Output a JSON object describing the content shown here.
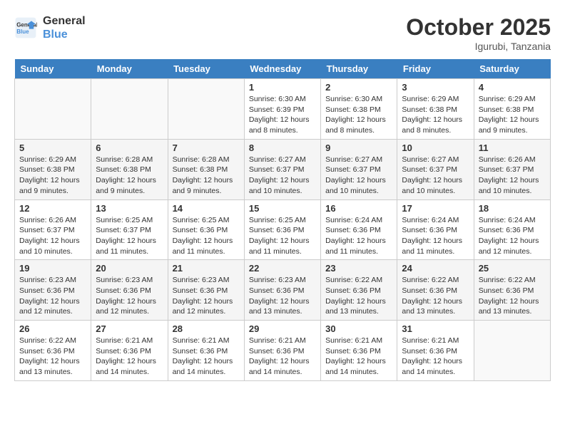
{
  "header": {
    "logo_line1": "General",
    "logo_line2": "Blue",
    "month": "October 2025",
    "location": "Igurubi, Tanzania"
  },
  "weekdays": [
    "Sunday",
    "Monday",
    "Tuesday",
    "Wednesday",
    "Thursday",
    "Friday",
    "Saturday"
  ],
  "weeks": [
    [
      {
        "day": "",
        "info": ""
      },
      {
        "day": "",
        "info": ""
      },
      {
        "day": "",
        "info": ""
      },
      {
        "day": "1",
        "info": "Sunrise: 6:30 AM\nSunset: 6:39 PM\nDaylight: 12 hours\nand 8 minutes."
      },
      {
        "day": "2",
        "info": "Sunrise: 6:30 AM\nSunset: 6:38 PM\nDaylight: 12 hours\nand 8 minutes."
      },
      {
        "day": "3",
        "info": "Sunrise: 6:29 AM\nSunset: 6:38 PM\nDaylight: 12 hours\nand 8 minutes."
      },
      {
        "day": "4",
        "info": "Sunrise: 6:29 AM\nSunset: 6:38 PM\nDaylight: 12 hours\nand 9 minutes."
      }
    ],
    [
      {
        "day": "5",
        "info": "Sunrise: 6:29 AM\nSunset: 6:38 PM\nDaylight: 12 hours\nand 9 minutes."
      },
      {
        "day": "6",
        "info": "Sunrise: 6:28 AM\nSunset: 6:38 PM\nDaylight: 12 hours\nand 9 minutes."
      },
      {
        "day": "7",
        "info": "Sunrise: 6:28 AM\nSunset: 6:38 PM\nDaylight: 12 hours\nand 9 minutes."
      },
      {
        "day": "8",
        "info": "Sunrise: 6:27 AM\nSunset: 6:37 PM\nDaylight: 12 hours\nand 10 minutes."
      },
      {
        "day": "9",
        "info": "Sunrise: 6:27 AM\nSunset: 6:37 PM\nDaylight: 12 hours\nand 10 minutes."
      },
      {
        "day": "10",
        "info": "Sunrise: 6:27 AM\nSunset: 6:37 PM\nDaylight: 12 hours\nand 10 minutes."
      },
      {
        "day": "11",
        "info": "Sunrise: 6:26 AM\nSunset: 6:37 PM\nDaylight: 12 hours\nand 10 minutes."
      }
    ],
    [
      {
        "day": "12",
        "info": "Sunrise: 6:26 AM\nSunset: 6:37 PM\nDaylight: 12 hours\nand 10 minutes."
      },
      {
        "day": "13",
        "info": "Sunrise: 6:25 AM\nSunset: 6:37 PM\nDaylight: 12 hours\nand 11 minutes."
      },
      {
        "day": "14",
        "info": "Sunrise: 6:25 AM\nSunset: 6:36 PM\nDaylight: 12 hours\nand 11 minutes."
      },
      {
        "day": "15",
        "info": "Sunrise: 6:25 AM\nSunset: 6:36 PM\nDaylight: 12 hours\nand 11 minutes."
      },
      {
        "day": "16",
        "info": "Sunrise: 6:24 AM\nSunset: 6:36 PM\nDaylight: 12 hours\nand 11 minutes."
      },
      {
        "day": "17",
        "info": "Sunrise: 6:24 AM\nSunset: 6:36 PM\nDaylight: 12 hours\nand 11 minutes."
      },
      {
        "day": "18",
        "info": "Sunrise: 6:24 AM\nSunset: 6:36 PM\nDaylight: 12 hours\nand 12 minutes."
      }
    ],
    [
      {
        "day": "19",
        "info": "Sunrise: 6:23 AM\nSunset: 6:36 PM\nDaylight: 12 hours\nand 12 minutes."
      },
      {
        "day": "20",
        "info": "Sunrise: 6:23 AM\nSunset: 6:36 PM\nDaylight: 12 hours\nand 12 minutes."
      },
      {
        "day": "21",
        "info": "Sunrise: 6:23 AM\nSunset: 6:36 PM\nDaylight: 12 hours\nand 12 minutes."
      },
      {
        "day": "22",
        "info": "Sunrise: 6:23 AM\nSunset: 6:36 PM\nDaylight: 12 hours\nand 13 minutes."
      },
      {
        "day": "23",
        "info": "Sunrise: 6:22 AM\nSunset: 6:36 PM\nDaylight: 12 hours\nand 13 minutes."
      },
      {
        "day": "24",
        "info": "Sunrise: 6:22 AM\nSunset: 6:36 PM\nDaylight: 12 hours\nand 13 minutes."
      },
      {
        "day": "25",
        "info": "Sunrise: 6:22 AM\nSunset: 6:36 PM\nDaylight: 12 hours\nand 13 minutes."
      }
    ],
    [
      {
        "day": "26",
        "info": "Sunrise: 6:22 AM\nSunset: 6:36 PM\nDaylight: 12 hours\nand 13 minutes."
      },
      {
        "day": "27",
        "info": "Sunrise: 6:21 AM\nSunset: 6:36 PM\nDaylight: 12 hours\nand 14 minutes."
      },
      {
        "day": "28",
        "info": "Sunrise: 6:21 AM\nSunset: 6:36 PM\nDaylight: 12 hours\nand 14 minutes."
      },
      {
        "day": "29",
        "info": "Sunrise: 6:21 AM\nSunset: 6:36 PM\nDaylight: 12 hours\nand 14 minutes."
      },
      {
        "day": "30",
        "info": "Sunrise: 6:21 AM\nSunset: 6:36 PM\nDaylight: 12 hours\nand 14 minutes."
      },
      {
        "day": "31",
        "info": "Sunrise: 6:21 AM\nSunset: 6:36 PM\nDaylight: 12 hours\nand 14 minutes."
      },
      {
        "day": "",
        "info": ""
      }
    ]
  ]
}
